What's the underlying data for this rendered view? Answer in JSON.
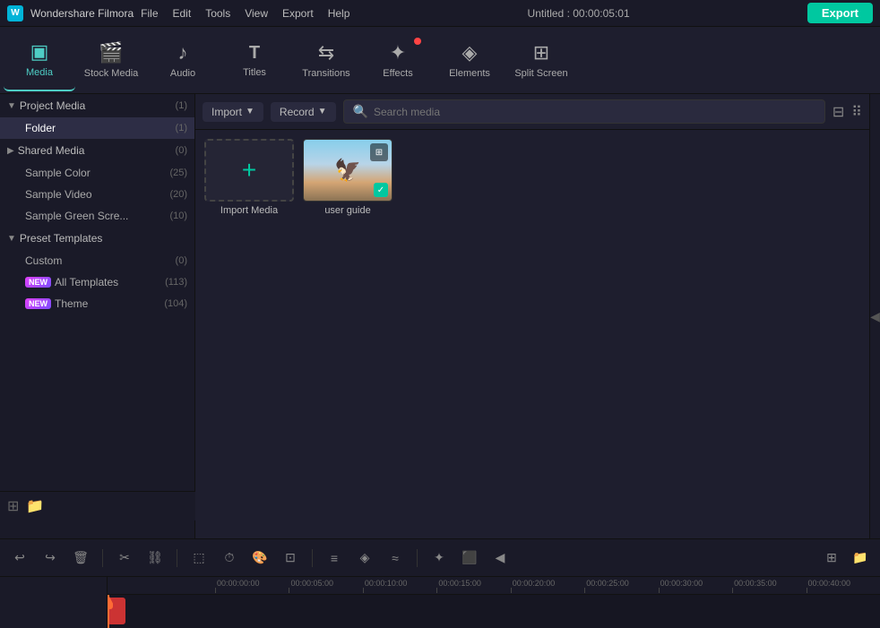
{
  "titleBar": {
    "appName": "Wondershare Filmora",
    "menus": [
      "File",
      "Edit",
      "Tools",
      "View",
      "Export",
      "Help"
    ],
    "projectInfo": "Untitled : 00:00:05:01",
    "exportLabel": "Export"
  },
  "toolbar": {
    "items": [
      {
        "id": "media",
        "label": "Media",
        "icon": "▣",
        "active": true
      },
      {
        "id": "stock-media",
        "label": "Stock Media",
        "icon": "🎬"
      },
      {
        "id": "audio",
        "label": "Audio",
        "icon": "♪"
      },
      {
        "id": "titles",
        "label": "Titles",
        "icon": "T"
      },
      {
        "id": "transitions",
        "label": "Transitions",
        "icon": "⇆"
      },
      {
        "id": "effects",
        "label": "Effects",
        "icon": "✦",
        "badge": true
      },
      {
        "id": "elements",
        "label": "Elements",
        "icon": "◈"
      },
      {
        "id": "split-screen",
        "label": "Split Screen",
        "icon": "⊞"
      }
    ]
  },
  "sidebar": {
    "sections": [
      {
        "id": "project-media",
        "label": "Project Media",
        "count": "(1)",
        "expanded": true,
        "children": [
          {
            "id": "folder",
            "label": "Folder",
            "count": "(1)",
            "active": true
          }
        ]
      },
      {
        "id": "shared-media",
        "label": "Shared Media",
        "count": "(0)",
        "expanded": false,
        "children": [
          {
            "id": "sample-color",
            "label": "Sample Color",
            "count": "(25)"
          },
          {
            "id": "sample-video",
            "label": "Sample Video",
            "count": "(20)"
          },
          {
            "id": "sample-green-screen",
            "label": "Sample Green Scre...",
            "count": "(10)"
          }
        ]
      },
      {
        "id": "preset-templates",
        "label": "Preset Templates",
        "count": "",
        "expanded": true,
        "children": [
          {
            "id": "custom",
            "label": "Custom",
            "count": "(0)"
          },
          {
            "id": "all-templates",
            "label": "All Templates",
            "count": "(113)",
            "isNew": true
          },
          {
            "id": "theme",
            "label": "Theme",
            "count": "(104)",
            "isNew": true
          }
        ]
      }
    ]
  },
  "contentBar": {
    "importLabel": "Import",
    "recordLabel": "Record",
    "searchPlaceholder": "Search media"
  },
  "mediaGrid": {
    "items": [
      {
        "id": "import",
        "type": "import",
        "label": "Import Media"
      },
      {
        "id": "user-guide",
        "type": "video",
        "label": "user guide"
      }
    ]
  },
  "timeline": {
    "buttons": [
      {
        "id": "undo",
        "icon": "↩",
        "label": "Undo"
      },
      {
        "id": "redo",
        "icon": "↪",
        "label": "Redo"
      },
      {
        "id": "delete",
        "icon": "🗑",
        "label": "Delete"
      },
      {
        "id": "cut",
        "icon": "✂",
        "label": "Cut"
      },
      {
        "id": "unlink",
        "icon": "⛓",
        "label": "Unlink"
      },
      {
        "id": "crop",
        "icon": "⬚",
        "label": "Crop"
      },
      {
        "id": "speed",
        "icon": "⏱",
        "label": "Speed"
      },
      {
        "id": "color",
        "icon": "🎨",
        "label": "Color"
      },
      {
        "id": "stabilize",
        "icon": "⊡",
        "label": "Stabilize"
      },
      {
        "id": "audio-mixer",
        "icon": "≡",
        "label": "Audio Mixer"
      },
      {
        "id": "transform",
        "icon": "◈",
        "label": "Transform"
      },
      {
        "id": "motion-blur",
        "icon": "≈",
        "label": "Motion Blur"
      },
      {
        "id": "ai-tools",
        "icon": "✦",
        "label": "AI Tools"
      },
      {
        "id": "camera",
        "icon": "⬛",
        "label": "Camera"
      },
      {
        "id": "keyframe",
        "icon": "◀",
        "label": "Keyframe"
      }
    ],
    "rulerMarks": [
      "00:00:00:00",
      "00:00:05:00",
      "00:00:10:00",
      "00:00:15:00",
      "00:00:20:00",
      "00:00:25:00",
      "00:00:30:00",
      "00:00:35:00",
      "00:00:40:00"
    ],
    "addTrackLabel": "+",
    "addFolderLabel": "📁"
  },
  "icons": {
    "arrow-down": "▼",
    "arrow-right": "▶",
    "filter": "⊟",
    "grid": "⠿",
    "search": "🔍",
    "check": "✓",
    "grid2": "⊞"
  }
}
